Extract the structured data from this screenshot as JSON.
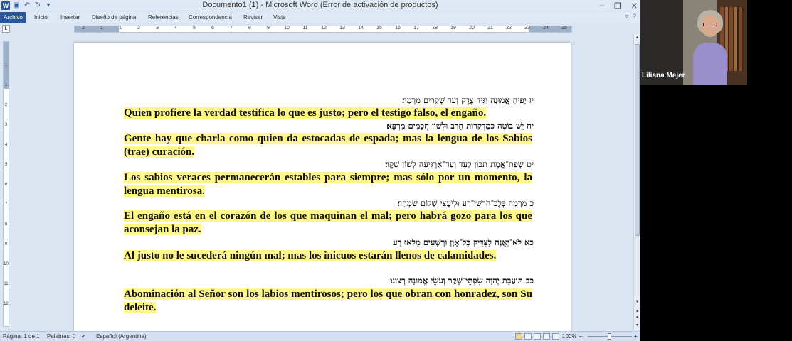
{
  "window": {
    "title": "Documento1 (1)  -  Microsoft Word (Error de activación de productos)",
    "controls": [
      "–",
      "❐",
      "✕"
    ]
  },
  "ribbon": {
    "tabs": [
      "Archivo",
      "Inicio",
      "Insertar",
      "Diseño de página",
      "Referencias",
      "Correspondencia",
      "Revisar",
      "Vista"
    ],
    "active_tab": "Archivo",
    "help_icon": "?"
  },
  "ruler": {
    "tab_selector": "L",
    "h_numbers": [
      "2",
      "1",
      "1",
      "2",
      "3",
      "4",
      "5",
      "6",
      "7",
      "8",
      "9",
      "10",
      "11",
      "12",
      "13",
      "14",
      "15",
      "16",
      "17",
      "18",
      "19",
      "20",
      "21",
      "22",
      "23",
      "24",
      "25"
    ],
    "v_numbers": [
      "1",
      "1",
      "2",
      "3",
      "4",
      "5",
      "6",
      "7",
      "8",
      "9",
      "10",
      "11",
      "12"
    ]
  },
  "document": {
    "verses": [
      {
        "hebrew": "יז יָפִיחַ אֱמוּנָה יַגִּיד צֶדֶק וְעֵד שְׁקָרִים מִרְמָה׃",
        "spanish": "Quien profiere la verdad testifica lo que es justo; pero el testigo falso, el engaño."
      },
      {
        "hebrew": "יח יֵשׁ בּוֹטֶה כְּמַדְקְרוֹת חָרֶב וּלְשׁוֹן חֲכָמִים מַרְפֵּא׃",
        "spanish": "Gente hay que charla como quien da estocadas de espada; mas la lengua de los Sabios (trae) curación."
      },
      {
        "hebrew": "יט שְׂפַת־אֱמֶת תִּכּוֹן לָעַד וְעַד־אַרְגִּיעָה לְשׁוֹן שָׁקֶר׃",
        "spanish": "Los sabios veraces permanecerán estables para siempre; mas sólo por un momento, la lengua mentirosa."
      },
      {
        "hebrew": "כ מִרְמָה בְּלֶב־חֹרְשֵׁי־רָע וּלְיֹעֲצֵי שָׁלוֹם שִׂמְחָה׃",
        "spanish": "El engaño está en el corazón de los que maquinan el mal; pero habrá gozo para los que aconsejan la paz."
      },
      {
        "hebrew": "כא לֹא־יְאֻנֶּה לַצַּדִּיק כָּל־אָוֶן וּרְשָׁעִים מָלְאוּ רָע׃",
        "spanish": "Al justo no le sucederá ningún mal; mas los inicuos estarán llenos de calamidades."
      },
      {
        "hebrew": "כב תּוֹעֲבַת יְהוָה שִׂפְתֵי־שָׁקֶר וְעֹשֵׂי אֱמוּנָה רְצוֹנוֹ׃",
        "spanish": "Abominación al Señor son los labios mentirosos; pero los que obran con honradez, son Su deleite."
      }
    ]
  },
  "statusbar": {
    "page": "Página: 1 de 1",
    "words": "Palabras: 0",
    "language": "Español (Argentina)",
    "zoom": "100%",
    "zoom_minus": "–",
    "zoom_plus": "+"
  },
  "video": {
    "participant_name": "Liliana Mejer"
  }
}
